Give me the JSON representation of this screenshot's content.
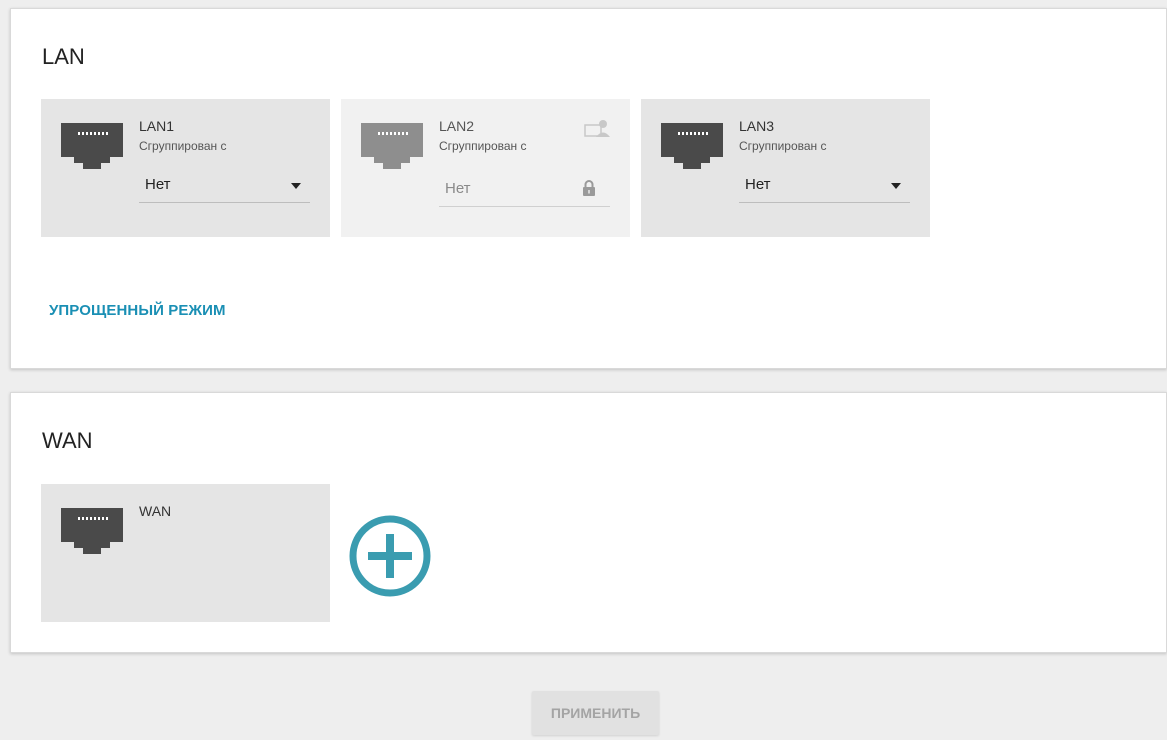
{
  "lan": {
    "title": "LAN",
    "ports": [
      {
        "name": "LAN1",
        "group_label": "Сгруппирован с",
        "value": "Нет",
        "locked": false
      },
      {
        "name": "LAN2",
        "group_label": "Сгруппирован с",
        "value": "Нет",
        "locked": true
      },
      {
        "name": "LAN3",
        "group_label": "Сгруппирован с",
        "value": "Нет",
        "locked": false
      }
    ],
    "simple_mode_label": "УПРОЩЕННЫЙ РЕЖИМ"
  },
  "wan": {
    "title": "WAN",
    "ports": [
      {
        "name": "WAN"
      }
    ]
  },
  "apply_label": "ПРИМЕНИТЬ",
  "colors": {
    "accent": "#1a8fb4",
    "add_icon": "#3a9cb0",
    "port_icon_active": "#4a4a4a",
    "port_icon_disabled": "#8e8e8e"
  },
  "icons": [
    "ethernet-port-icon",
    "dropdown-caret-icon",
    "lock-icon",
    "user-icon",
    "add-circle-icon"
  ]
}
